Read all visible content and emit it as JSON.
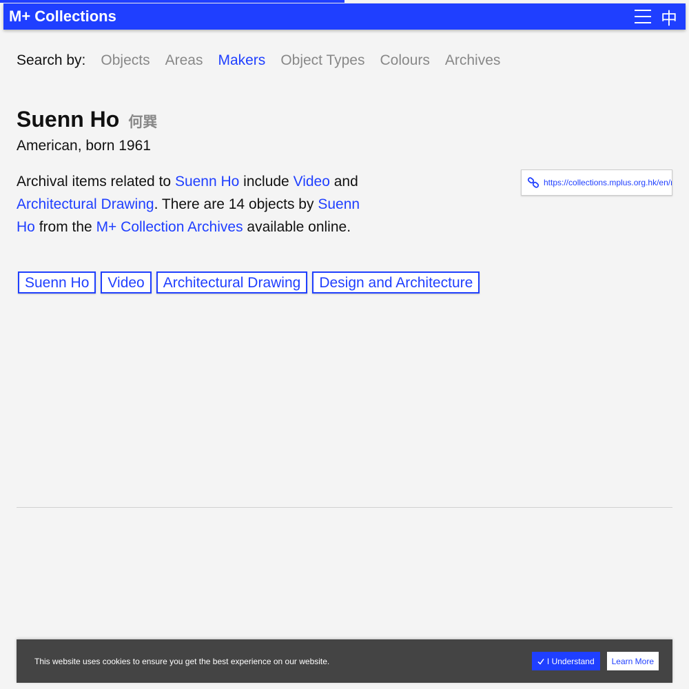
{
  "progress": {
    "fraction": 0.5
  },
  "header": {
    "brand": "M+ Collections",
    "menu_icon": "hamburger-icon",
    "lang_label": "中"
  },
  "search_by": {
    "label": "Search by:",
    "items": [
      {
        "label": "Objects",
        "active": false
      },
      {
        "label": "Areas",
        "active": false
      },
      {
        "label": "Makers",
        "active": true
      },
      {
        "label": "Object Types",
        "active": false
      },
      {
        "label": "Colours",
        "active": false
      },
      {
        "label": "Archives",
        "active": false
      }
    ]
  },
  "maker": {
    "name": "Suenn Ho",
    "name_cjk": "何巽",
    "subtitle": "American, born 1961"
  },
  "description": {
    "t1": "Archival items related to ",
    "l1": "Suenn Ho",
    "t2": " include ",
    "l2": "Video",
    "t3": " and ",
    "l3": "Architectural Drawing",
    "t4": ". There are 14 objects by ",
    "l4": "Suenn Ho",
    "t5": " from the ",
    "l5": "M+ Collection Archives",
    "t6": " available online."
  },
  "share_link": {
    "icon": "link-icon",
    "url": "https://collections.mplus.org.hk/en/m"
  },
  "tags": [
    "Suenn Ho",
    "Video",
    "Architectural Drawing",
    "Design and Architecture"
  ],
  "cookie": {
    "message": "This website uses cookies to ensure you get the best experience on our website.",
    "accept_label": "I Understand",
    "learn_label": "Learn More"
  },
  "colors": {
    "accent": "#1f3fff",
    "cookie_bg": "#444444",
    "muted": "#888888"
  }
}
